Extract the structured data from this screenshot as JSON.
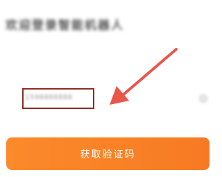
{
  "page": {
    "title": "欢迎登录智能机器人"
  },
  "phone_field": {
    "value": "1598888888"
  },
  "submit": {
    "label": "获取验证码"
  },
  "colors": {
    "button": "#f8822a",
    "highlight_border": "#8e2b22",
    "arrow": "#e8574a"
  },
  "icons": {
    "clear": "clear-icon",
    "annotation": "arrow-icon"
  }
}
